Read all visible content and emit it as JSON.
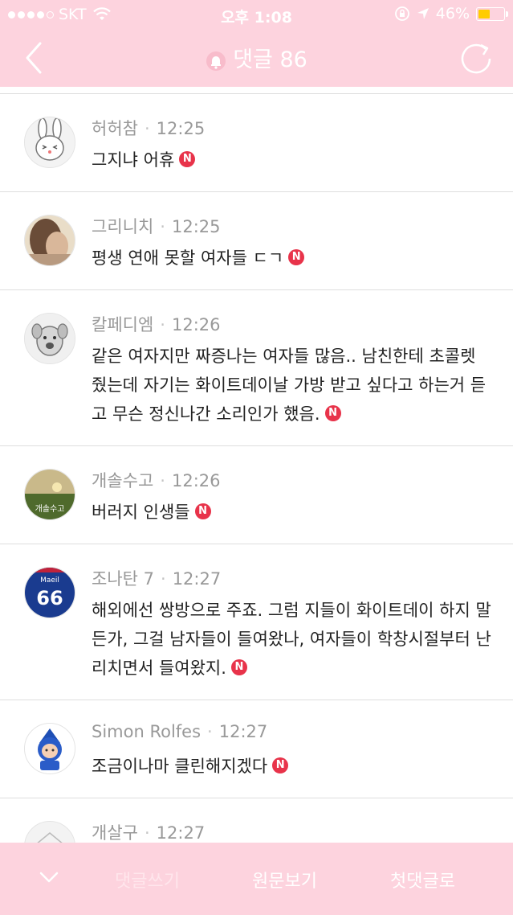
{
  "status_bar": {
    "carrier": "SKT",
    "time": "오후 1:08",
    "battery": "46%",
    "battery_level": 0.46
  },
  "header": {
    "title": "댓글 86",
    "back_icon": "chevron-left-icon",
    "bell_icon": "bell-icon",
    "refresh_icon": "refresh-icon"
  },
  "comments": [
    {
      "author": "허허참",
      "time": "12:25",
      "text": "그지냐 어휴",
      "avatar": "rabbit-avatar"
    },
    {
      "author": "그리니치",
      "time": "12:25",
      "text": "평생 연애 못할 여자들 ㄷㄱ",
      "avatar": "photo-avatar"
    },
    {
      "author": "칼페디엠",
      "time": "12:26",
      "text": "같은 여자지만 짜증나는 여자들 많음.. 남친한테 초콜렛 줬는데 자기는 화이트데이날 가방 받고 싶다고 하는거 듣고 무슨 정신나간 소리인가 했음.",
      "avatar": "dog-avatar"
    },
    {
      "author": "개솔수고",
      "time": "12:26",
      "text": "버러지 인생들",
      "avatar": "landscape-avatar"
    },
    {
      "author": "조나탄 7",
      "time": "12:27",
      "text": "해외에선 쌍방으로 주죠. 그럼 지들이 화이트데이 하지 말든가, 그걸 남자들이 들여왔나, 여자들이 학창시절부터 난리치면서 들여왔지.",
      "avatar": "jersey-avatar"
    },
    {
      "author": "Simon Rolfes",
      "time": "12:27",
      "text": "조금이나마  클린해지겠다",
      "avatar": "cartoon-avatar"
    },
    {
      "author": "개살구",
      "time": "12:27",
      "text": "",
      "avatar": "default-avatar"
    }
  ],
  "new_badge": "N",
  "jersey_number": "66",
  "jersey_brand": "Maeil",
  "avatar_caption": "개솔수고",
  "bottom_bar": {
    "write_label": "댓글쓰기",
    "original_label": "원문보기",
    "first_label": "첫댓글로"
  },
  "colors": {
    "header_bg": "#fdd3de",
    "badge": "#e8334a",
    "meta_text": "#999999"
  }
}
